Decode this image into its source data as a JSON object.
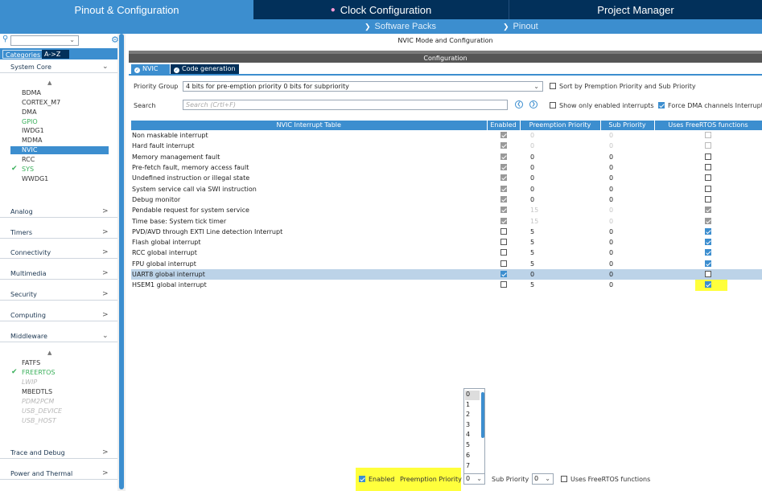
{
  "top_tabs": {
    "pinout": "Pinout & Configuration",
    "clock": "Clock Configuration",
    "project": "Project Manager"
  },
  "sub_menu": {
    "software_packs": "Software Packs",
    "pinout": "Pinout"
  },
  "sidebar": {
    "categories_tab": "Categories",
    "az_tab": "A->Z",
    "system_core": "System Core",
    "system_items": [
      "BDMA",
      "CORTEX_M7",
      "DMA",
      "GPIO",
      "IWDG1",
      "MDMA",
      "NVIC",
      "RCC",
      "SYS",
      "WWDG1"
    ],
    "sections": [
      "Analog",
      "Timers",
      "Connectivity",
      "Multimedia",
      "Security",
      "Computing",
      "Middleware"
    ],
    "middleware_items": [
      "FATFS",
      "FREERTOS",
      "LWIP",
      "MBEDTLS",
      "PDM2PCM",
      "USB_DEVICE",
      "USB_HOST"
    ],
    "bottom_sections": [
      "Trace and Debug",
      "Power and Thermal"
    ]
  },
  "main": {
    "mode_title": "NVIC Mode and Configuration",
    "configuration_title": "Configuration",
    "tab_nvic": "NVIC",
    "tab_codegen": "Code generation",
    "priority_group_label": "Priority Group",
    "priority_group_value": "4 bits for pre-emption priority 0 bits for subpriority",
    "sort_label": "Sort by Premption Priority and Sub Priority",
    "search_label": "Search",
    "search_placeholder": "Search (Crtl+F)",
    "show_enabled_label": "Show only enabled interrupts",
    "force_dma_label": "Force DMA channels Interrupts"
  },
  "table": {
    "headers": [
      "NVIC Interrupt Table",
      "Enabled",
      "Preemption Priority",
      "Sub Priority",
      "Uses FreeRTOS functions"
    ],
    "rows": [
      {
        "name": "Non maskable interrupt",
        "pre": "0",
        "sub": "0"
      },
      {
        "name": "Hard fault interrupt",
        "pre": "0",
        "sub": "0"
      },
      {
        "name": "Memory management fault",
        "pre": "0",
        "sub": "0"
      },
      {
        "name": "Pre-fetch fault, memory access fault",
        "pre": "0",
        "sub": "0"
      },
      {
        "name": "Undefined instruction or illegal state",
        "pre": "0",
        "sub": "0"
      },
      {
        "name": "System service call via SWI instruction",
        "pre": "0",
        "sub": "0"
      },
      {
        "name": "Debug monitor",
        "pre": "0",
        "sub": "0"
      },
      {
        "name": "Pendable request for system service",
        "pre": "15",
        "sub": "0"
      },
      {
        "name": "Time base: System tick timer",
        "pre": "15",
        "sub": "0"
      },
      {
        "name": "PVD/AVD through EXTI Line detection Interrupt",
        "pre": "5",
        "sub": "0"
      },
      {
        "name": "Flash global interrupt",
        "pre": "5",
        "sub": "0"
      },
      {
        "name": "RCC global interrupt",
        "pre": "5",
        "sub": "0"
      },
      {
        "name": "FPU global interrupt",
        "pre": "5",
        "sub": "0"
      },
      {
        "name": "UART8 global interrupt",
        "pre": "0",
        "sub": "0"
      },
      {
        "name": "HSEM1 global interrupt",
        "pre": "5",
        "sub": "0"
      }
    ]
  },
  "bottom": {
    "enabled_label": "Enabled",
    "preemption_label": "Preemption Priority",
    "preemption_value": "0",
    "sub_label": "Sub Priority",
    "sub_value": "0",
    "freertos_label": "Uses FreeRTOS functions",
    "dropdown_options": [
      "0",
      "1",
      "2",
      "3",
      "4",
      "5",
      "6",
      "7"
    ]
  }
}
